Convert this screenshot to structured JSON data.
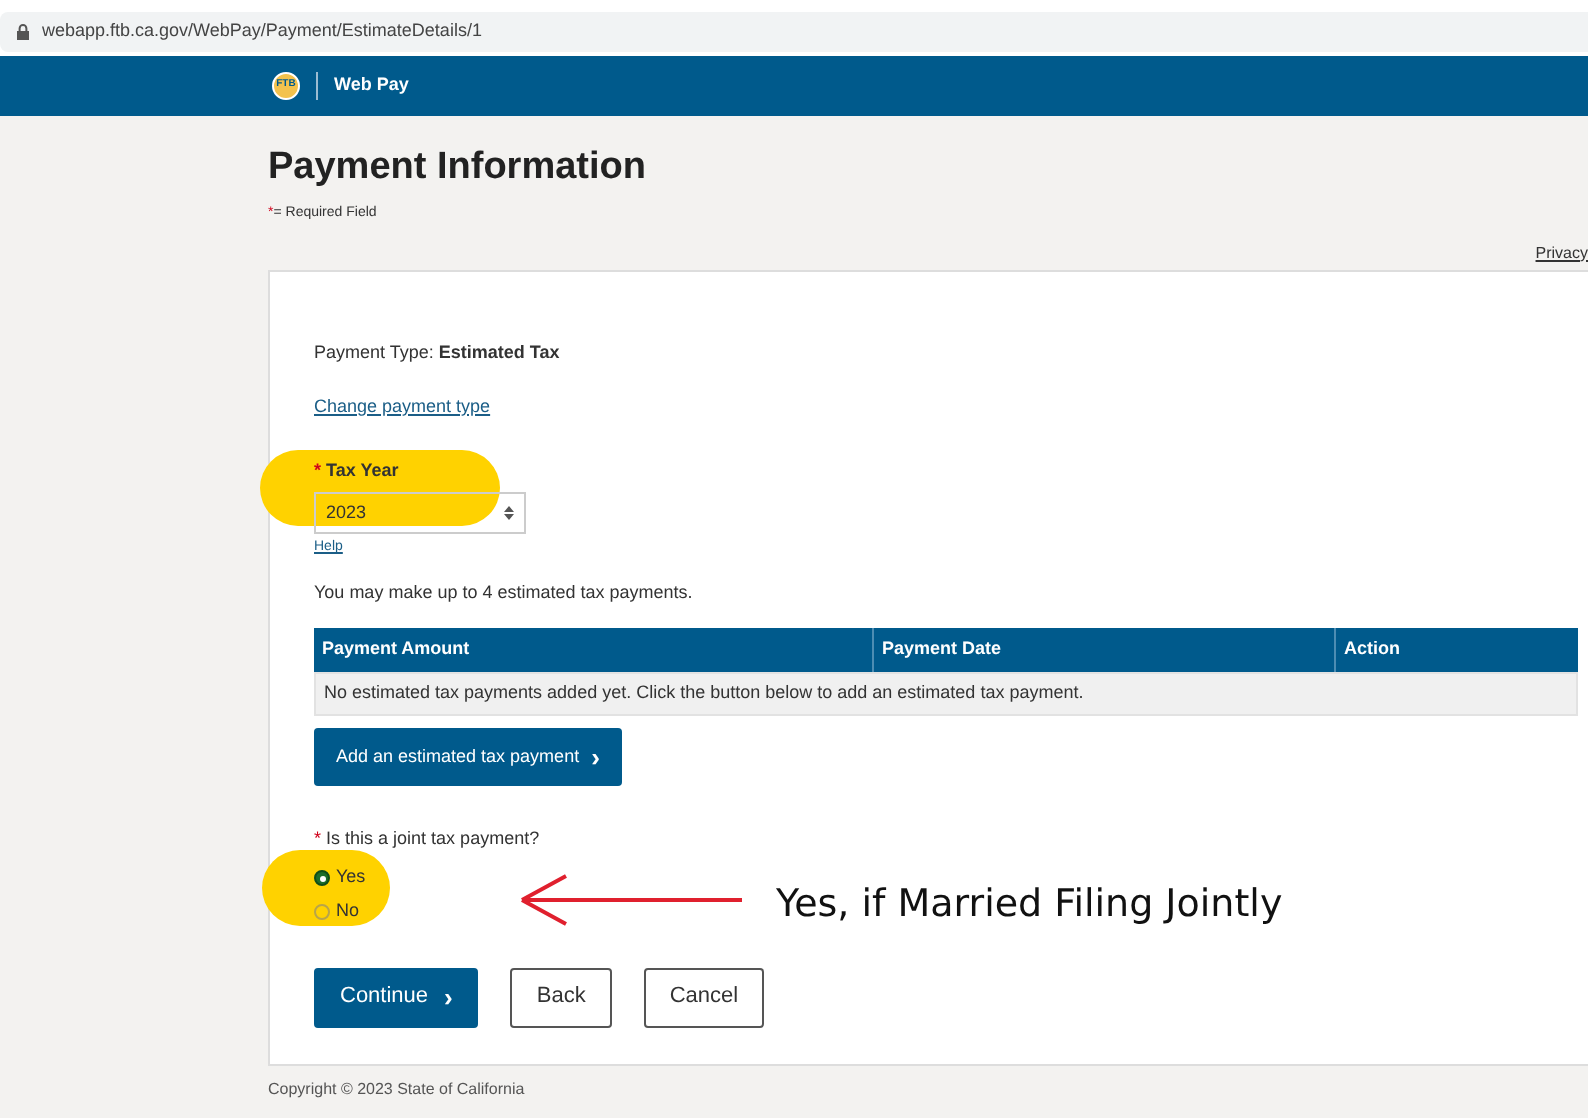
{
  "address_bar": {
    "url": "webapp.ftb.ca.gov/WebPay/Payment/EstimateDetails/1"
  },
  "header": {
    "logo_text": "FTB",
    "title": "Web Pay"
  },
  "page": {
    "title": "Payment Information",
    "required_marker": "*",
    "required_note": "= Required Field",
    "privacy_link": "Privacy"
  },
  "form": {
    "payment_type_label": "Payment Type:",
    "payment_type_value": "Estimated Tax",
    "change_link": "Change payment type",
    "tax_year": {
      "required_marker": "*",
      "label": "Tax Year",
      "value": "2023",
      "help_link": "Help"
    },
    "info_text": "You may make up to 4 estimated tax payments.",
    "table": {
      "columns": [
        "Payment Amount",
        "Payment Date",
        "Action"
      ],
      "empty_message": "No estimated tax payments added yet. Click the button below to add an estimated tax payment."
    },
    "add_button": {
      "label": "Add an estimated tax payment",
      "icon": "›"
    },
    "joint": {
      "required_marker": "*",
      "label": "Is this a joint tax payment?",
      "options": [
        {
          "label": "Yes",
          "selected": true
        },
        {
          "label": "No",
          "selected": false
        }
      ]
    },
    "buttons": [
      {
        "label": "Continue",
        "icon": "›",
        "kind": "primary"
      },
      {
        "label": "Back",
        "kind": "secondary"
      },
      {
        "label": "Cancel",
        "kind": "secondary"
      }
    ]
  },
  "annotation": {
    "text": "Yes, if Married Filing Jointly"
  },
  "footer": {
    "copyright": "Copyright © 2023 State of California"
  }
}
